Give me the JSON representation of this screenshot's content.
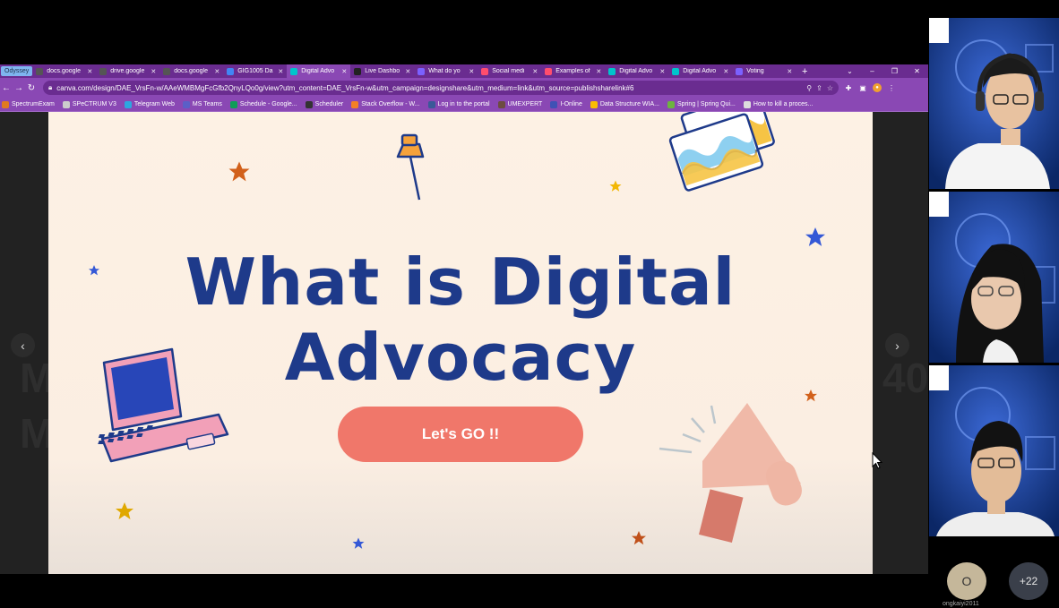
{
  "browser": {
    "profile_chip": "Odyssey",
    "tabs": [
      {
        "title": "docs.google",
        "fav_color": "#555555",
        "active": false
      },
      {
        "title": "drive.google",
        "fav_color": "#555555",
        "active": false
      },
      {
        "title": "docs.google",
        "fav_color": "#555555",
        "active": false
      },
      {
        "title": "GIG1005 Da",
        "fav_color": "#4285f4",
        "active": false
      },
      {
        "title": "Digital Advo",
        "fav_color": "#00c4cc",
        "active": true
      },
      {
        "title": "Live Dashbo",
        "fav_color": "#222222",
        "active": false
      },
      {
        "title": "What do yo",
        "fav_color": "#7b61ff",
        "active": false
      },
      {
        "title": "Social medi",
        "fav_color": "#ff4d6d",
        "active": false
      },
      {
        "title": "Examples of",
        "fav_color": "#ff4d6d",
        "active": false
      },
      {
        "title": "Digital Advo",
        "fav_color": "#00c4cc",
        "active": false
      },
      {
        "title": "Digital Advo",
        "fav_color": "#00c4cc",
        "active": false
      },
      {
        "title": "Voting",
        "fav_color": "#7b61ff",
        "active": false
      }
    ],
    "new_tab": "+",
    "url": "canva.com/design/DAE_VrsFn-w/AAeWMBMgFcGfb2QnyLQo0g/view?utm_content=DAE_VrsFn-w&utm_campaign=designshare&utm_medium=link&utm_source=publishsharelink#6",
    "bookmarks": [
      {
        "label": "SpectrumExam",
        "color": "#e07a20"
      },
      {
        "label": "SPeCTRUM V3",
        "color": "#cccccc"
      },
      {
        "label": "Telegram Web",
        "color": "#2ea6e0"
      },
      {
        "label": "MS Teams",
        "color": "#5b5fc7"
      },
      {
        "label": "Schedule - Google...",
        "color": "#0f9d58"
      },
      {
        "label": "Scheduler",
        "color": "#333333"
      },
      {
        "label": "Stack Overflow - W...",
        "color": "#f48024"
      },
      {
        "label": "Log in to the portal",
        "color": "#3b5998"
      },
      {
        "label": "UMEXPERT",
        "color": "#6d4c41"
      },
      {
        "label": "I-Online",
        "color": "#3f51b5"
      },
      {
        "label": "Data Structure WIA...",
        "color": "#fbbc04"
      },
      {
        "label": "Spring | Spring Qui...",
        "color": "#6db33f"
      },
      {
        "label": "How to kill a proces...",
        "color": "#dddddd"
      }
    ]
  },
  "slide": {
    "title_line1": "What is Digital",
    "title_line2": "Advocacy",
    "cta_label": "Let's GO !!",
    "accent_blue": "#1e3a8a",
    "cta_color": "#f0776a"
  },
  "meeting": {
    "avatar_initial": "O",
    "more_participants": "+22",
    "name_label": "ongkaiyi2011"
  }
}
